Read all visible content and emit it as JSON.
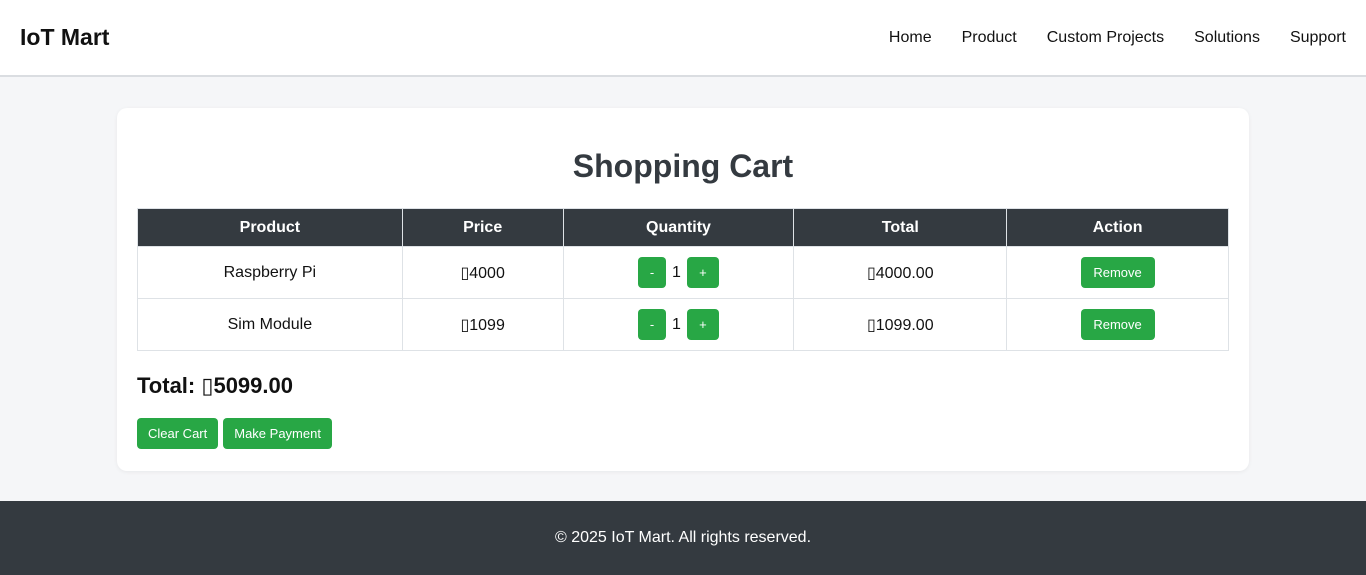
{
  "header": {
    "brand": "IoT Mart",
    "nav": [
      "Home",
      "Product",
      "Custom Projects",
      "Solutions",
      "Support"
    ]
  },
  "cart": {
    "title": "Shopping Cart",
    "columns": [
      "Product",
      "Price",
      "Quantity",
      "Total",
      "Action"
    ],
    "rows": [
      {
        "product": "Raspberry Pi",
        "price": "▯4000",
        "qty": "1",
        "total": "▯4000.00",
        "minus": "-",
        "plus": "+",
        "action": "Remove"
      },
      {
        "product": "Sim Module",
        "price": "▯1099",
        "qty": "1",
        "total": "▯1099.00",
        "minus": "-",
        "plus": "+",
        "action": "Remove"
      }
    ],
    "grand_total": "Total: ▯5099.00",
    "clear_label": "Clear Cart",
    "pay_label": "Make Payment"
  },
  "footer": {
    "text": "© 2025 IoT Mart. All rights reserved."
  },
  "colors": {
    "accent": "#28a745",
    "dark": "#343a40",
    "background": "#f5f6f8"
  }
}
